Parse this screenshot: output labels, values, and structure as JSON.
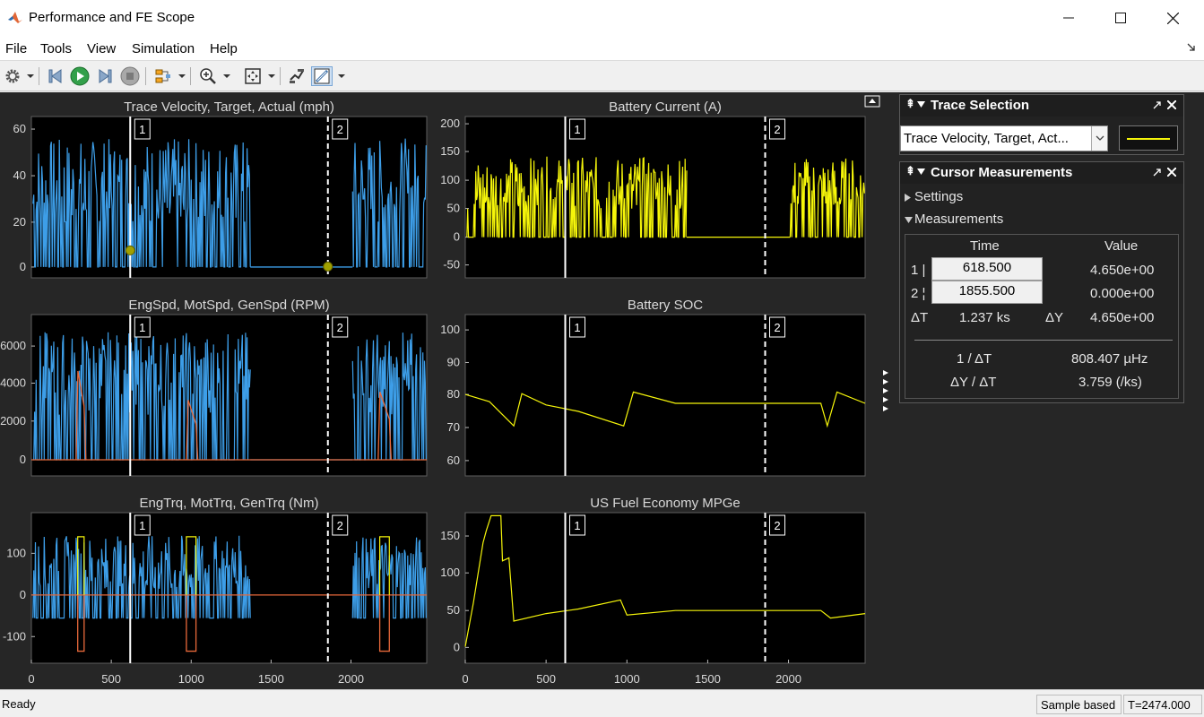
{
  "window": {
    "title": "Performance and FE Scope"
  },
  "menu": [
    "File",
    "Tools",
    "View",
    "Simulation",
    "Help"
  ],
  "toolbar": {
    "icons": [
      "gear-icon",
      "step-back-icon",
      "run-icon",
      "step-forward-icon",
      "stop-icon",
      "highlight-block-icon",
      "zoom-in-icon",
      "zoom-fit-icon",
      "signal-selector-icon",
      "cursor-measurements-icon"
    ]
  },
  "colors": {
    "blue": "#3d9ee8",
    "orange": "#e8693a",
    "yellow": "#f5f50a",
    "axes_bg": "#000000",
    "figure_bg": "#262626"
  },
  "plots": [
    {
      "id": "velocity",
      "title": "Trace Velocity, Target, Actual (mph)",
      "yticks": [
        "60",
        "40",
        "20",
        "0"
      ],
      "xticks": []
    },
    {
      "id": "battery-current",
      "title": "Battery Current (A)",
      "yticks": [
        "200",
        "150",
        "100",
        "50",
        "0",
        "-50"
      ],
      "xticks": []
    },
    {
      "id": "speeds",
      "title": "EngSpd, MotSpd, GenSpd (RPM)",
      "yticks": [
        "6000",
        "4000",
        "2000",
        "0"
      ],
      "xticks": []
    },
    {
      "id": "soc",
      "title": "Battery SOC",
      "yticks": [
        "100",
        "90",
        "80",
        "70",
        "60"
      ],
      "xticks": []
    },
    {
      "id": "torques",
      "title": "EngTrq, MotTrq, GenTrq (Nm)",
      "yticks": [
        "100",
        "0",
        "-100"
      ],
      "xticks": [
        "0",
        "500",
        "1000",
        "1500",
        "2000"
      ]
    },
    {
      "id": "fuel-economy",
      "title": "US Fuel Economy MPGe",
      "yticks": [
        "150",
        "100",
        "50",
        "0"
      ],
      "xticks": [
        "0",
        "500",
        "1000",
        "1500",
        "2000"
      ]
    }
  ],
  "cursors": {
    "label1": "1",
    "label2": "2"
  },
  "trace_selection": {
    "title": "Trace Selection",
    "selected": "Trace Velocity, Target, Act..."
  },
  "cursor_measurements": {
    "title": "Cursor Measurements",
    "settings_label": "Settings",
    "measurements_label": "Measurements",
    "col_time": "Time",
    "col_value": "Value",
    "row1_label": "1 |",
    "row1_time": "618.500",
    "row1_value": "4.650e+00",
    "row2_label": "2 ¦",
    "row2_time": "1855.500",
    "row2_value": "0.000e+00",
    "dt_label": "ΔT",
    "dt_value": "1.237 ks",
    "dy_label": "ΔY",
    "dy_value": "4.650e+00",
    "inv_dt_label": "1 / ΔT",
    "inv_dt_value": "808.407 µHz",
    "dydt_label": "ΔY / ΔT",
    "dydt_value": "3.759 (/ks)"
  },
  "status": {
    "text": "Ready",
    "mode": "Sample based",
    "time": "T=2474.000"
  }
}
